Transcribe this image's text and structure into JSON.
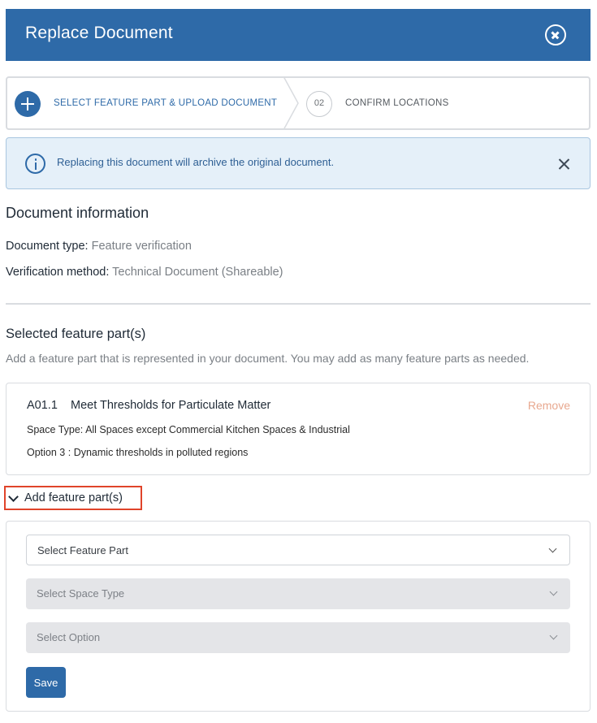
{
  "header": {
    "title": "Replace Document"
  },
  "stepper": {
    "step1_label": "SELECT FEATURE PART & UPLOAD DOCUMENT",
    "step2_number": "02",
    "step2_label": "CONFIRM LOCATIONS"
  },
  "alert": {
    "text": "Replacing this document will archive the original document."
  },
  "document_info": {
    "heading": "Document information",
    "type_label": "Document type:",
    "type_value": "Feature verification",
    "method_label": "Verification method:",
    "method_value": "Technical Document (Shareable)"
  },
  "selected": {
    "heading": "Selected feature part(s)",
    "description": "Add a feature part that is represented in your document. You may add as many feature parts as needed.",
    "features": [
      {
        "code": "A01.1",
        "name": "Meet Thresholds for Particulate Matter",
        "remove_label": "Remove",
        "space_label": "Space Type:",
        "space_value": "All Spaces except Commercial Kitchen Spaces & Industrial",
        "option_label": "Option 3",
        "option_value": ": Dynamic thresholds in polluted regions"
      }
    ]
  },
  "add_feature": {
    "toggle_label": "Add feature part(s)",
    "feature_placeholder": "Select Feature Part",
    "space_placeholder": "Select Space Type",
    "option_placeholder": "Select Option",
    "save_label": "Save"
  },
  "colors": {
    "brand": "#2e6aa8",
    "alert_bg": "#e5f0f9",
    "remove": "#e8a88f",
    "highlight": "#e0442a"
  }
}
